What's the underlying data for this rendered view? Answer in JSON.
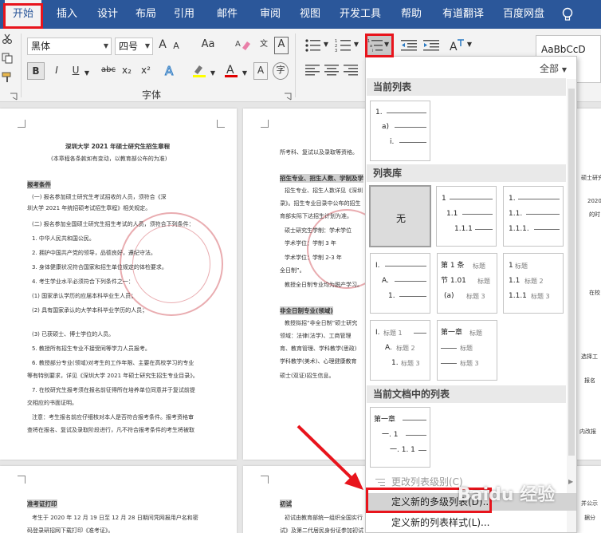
{
  "tabs": [
    "开始",
    "插入",
    "设计",
    "布局",
    "引用",
    "邮件",
    "审阅",
    "视图",
    "开发工具",
    "帮助",
    "有道翻译",
    "百度网盘"
  ],
  "font": {
    "name": "黑体",
    "size": "四号",
    "group_label": "字体"
  },
  "ribbon_glyphs": {
    "bold": "B",
    "strike": "abc",
    "sub": "x₂",
    "sup": "x²",
    "case": "Aa",
    "grow": "A",
    "shrink": "A",
    "sample_style": "AaBbCcD"
  },
  "panel": {
    "filter": "全部",
    "sections": {
      "current": "当前列表",
      "library": "列表库",
      "document": "当前文档中的列表"
    },
    "none_label": "无",
    "current_thumb": [
      "1.",
      "a)",
      "i."
    ],
    "lib": {
      "t2": [
        "1",
        "1.1",
        "1.1.1"
      ],
      "t3": [
        "1.",
        "1.1.",
        "1.1.1."
      ],
      "t4": [
        "I.",
        "A.",
        "1."
      ],
      "t5": [
        "第 1 条",
        "标题",
        "节 1.01",
        "标题",
        "(a)",
        "标题 3"
      ],
      "t6": [
        "1",
        "标题",
        "1.1",
        "标题 2",
        "1.1.1",
        "标题 3"
      ],
      "t7": [
        "I.",
        "标题 1",
        "A.",
        "标题 2",
        "1.",
        "标题 3"
      ],
      "t8": [
        "第一章",
        "标题",
        "标题",
        "标题 3"
      ]
    },
    "doc_thumb": [
      "第一章",
      "一. 1",
      "一. 1. 1"
    ],
    "menu": {
      "change_level": "更改列表级别(C)",
      "define_multilevel": "定义新的多级列表(D)...",
      "define_style": "定义新的列表样式(L)..."
    }
  },
  "doc": {
    "title": "深圳大学 2021 年硕士研究生招生章程",
    "subtitle": "(本章程各条款如有变动，以教育部公布的为准)",
    "h_apply": "报考条件",
    "l1": "(一) 报名参加硕士研究生考试招收的人员，须符合《深",
    "l2": "圳大学 2021 年统招硕考试招生章程》相关规定。",
    "l3": "(二) 报名参加全国硕士研究生招生考试的人员，须符合下列条件：",
    "l4": "1. 中华人民共和国公民。",
    "l5": "2. 拥护中国共产党的领导，品德良好，遵纪守法。",
    "l6": "3. 身体健康状况符合国家和招生单位规定的体检要求。",
    "l7": "4. 考生学业水平必须符合下列条件之一：",
    "l8": "(1) 国家承认学历的应届本科毕业生人员；",
    "l9": "(2) 具有国家承认的大学本科毕业学历的人员；",
    "l10": "(3) 已获硕士、博士学位的人员。",
    "l11": "5. 教授所有招生专业不接受同等学力人员报考。",
    "l12": "6. 教授部分专业(领域)对考生的工作年限、主要在高校学习的专业",
    "l13": "等有特别要求，详见《深圳大学 2021 年硕士研究生招生专业目录》。",
    "l14": "7. 在校研究生报考须在报名前征得所在培养单位同意并于复试前提",
    "l15": "交相应的书面证明。",
    "l16": "注意：考生报名前应仔细核对本人是否符合报考条件。报考资格审",
    "l17": "查将在报名、复试及录取阶段进行，凡不符合报考条件的考生将被取",
    "p2a": "所考科、复试以及录取等资格。",
    "p2h": "招生专业、招生人数、学制及学",
    "p2b": "招生专业、招生人数详见《深圳",
    "p2c": "录》。招生专业目录中公布的招生",
    "p2d": "育部实际下达招生计划为准。",
    "p2e": "硕士研究生学制：学术学位",
    "p2f": "学术学位：学制 3 年",
    "p2g": "学术学位：学制 2-3 年",
    "p2i": "全日制”。",
    "p2j": "教授全日制专业均为脱产学习。",
    "p2h2": "非全日制专业(领域)",
    "p2k": "教授拟招“非全日制”硕士研究",
    "p2l": "领域：法律(法学)、工商管理",
    "p2m": "育、教育管理、学科教学(思政)",
    "p2n": "学科教学(美术)、心理健康教育",
    "p2o": "硕士(双证)招生信息。",
    "h_print": "准考证打印",
    "p3a": "考生于 2020 年 12 月 19 日至 12 月 28 日期间凭网报用户名和密",
    "p3b": "码登录研招网下载打印《准考证》。",
    "h_exam": "初试",
    "p4a": "初试由教育部统一组织全国实行",
    "p4b": "试》及第二代居民身份证参加初试",
    "r1": "硕士研究",
    "r2": "2020",
    "r3": "的时",
    "r4": "在校",
    "r5": "选择工",
    "r6": "报名",
    "r7": "内改报",
    "r8": "并公示",
    "r9": "据分"
  },
  "watermark": "Baidu 经验"
}
